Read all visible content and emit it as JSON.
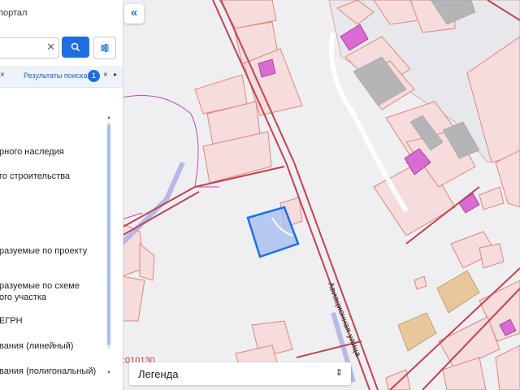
{
  "panel": {
    "portal_title": "портал",
    "search": {
      "value": "",
      "clear_icon": "close-icon",
      "search_icon": "search-icon",
      "filter_icon": "sliders-icon"
    },
    "tabs": {
      "first_close": "×",
      "results_label": "Результаты поиска",
      "results_count": "1",
      "results_close": "×",
      "next_arrow": "▸"
    },
    "layers": [
      "рного наследия",
      "го строительства",
      "разуемые по проекту",
      "разуемые по схеме",
      "ого участка",
      "ЕГРН",
      "вания (линейный)",
      "вания (полигональный)"
    ]
  },
  "map": {
    "collapse_icon": "«",
    "street_name": "Авиационная улица",
    "cadastral_fragment": ":010130",
    "legend_label": "Легенда",
    "legend_toggle": "⇕",
    "colors": {
      "background": "#efeff2",
      "parcel_fill": "#f6dcdc",
      "parcel_stroke": "#e0867b",
      "boundary_line": "#c2434f",
      "building_magenta": "#d96bd3",
      "building_gray": "#aaaaaa",
      "building_orange": "#e8c79c",
      "selected_parcel": "#a8c1f0",
      "selected_stroke": "#1f6fe5",
      "purple_line": "#b94ab4",
      "lavender_line": "#aeb0e4"
    }
  }
}
